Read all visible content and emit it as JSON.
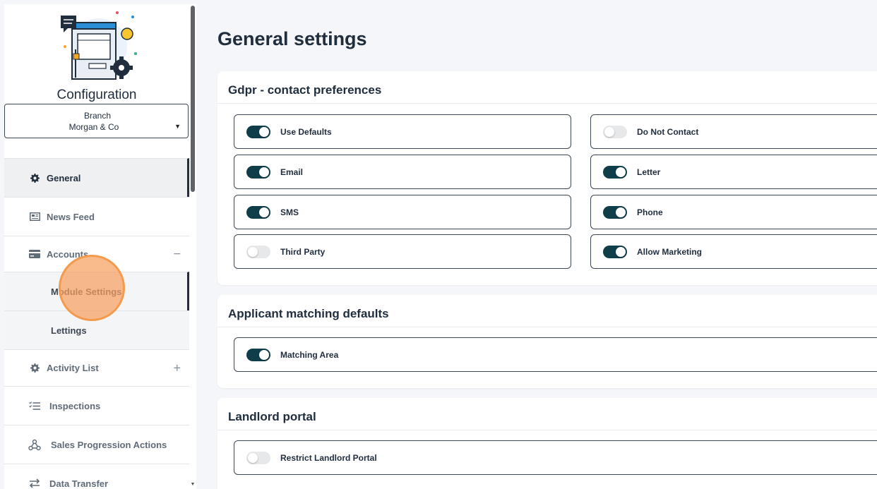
{
  "sidebar": {
    "title": "Configuration",
    "branch_select": {
      "label": "Branch",
      "value": "Morgan & Co"
    },
    "nav": {
      "general": "General",
      "news_feed": "News Feed",
      "accounts": "Accounts",
      "module_settings": "Module Settings",
      "lettings": "Lettings",
      "activity_list": "Activity List",
      "inspections": "Inspections",
      "sales_progression": "Sales Progression Actions",
      "data_transfer": "Data Transfer"
    },
    "accounts_expanded": true,
    "accounts_control": "−",
    "activity_list_control": "+"
  },
  "main": {
    "page_title": "General settings",
    "gdpr": {
      "title": "Gdpr - contact preferences",
      "settings": [
        {
          "label": "Use Defaults",
          "on": true
        },
        {
          "label": "Do Not Contact",
          "on": false
        },
        {
          "label": "Email",
          "on": true
        },
        {
          "label": "Letter",
          "on": true
        },
        {
          "label": "SMS",
          "on": true
        },
        {
          "label": "Phone",
          "on": true
        },
        {
          "label": "Third Party",
          "on": false
        },
        {
          "label": "Allow Marketing",
          "on": true
        }
      ]
    },
    "applicant": {
      "title": "Applicant matching defaults",
      "settings": [
        {
          "label": "Matching Area",
          "on": true
        }
      ]
    },
    "landlord": {
      "title": "Landlord portal",
      "settings": [
        {
          "label": "Restrict Landlord Portal",
          "on": false
        }
      ]
    }
  },
  "colors": {
    "toggle_on": "#0f3d4a",
    "toggle_off": "#e6e8ea",
    "text": "#1f2d3d",
    "highlight": "#f39a4d"
  }
}
